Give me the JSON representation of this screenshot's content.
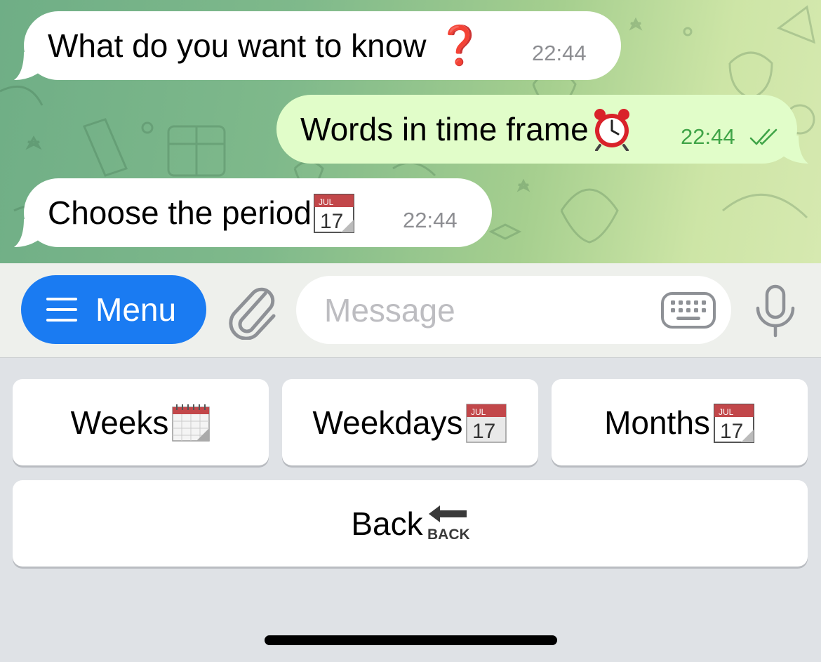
{
  "messages": [
    {
      "text": "What do you want to know",
      "emoji": "❓",
      "time": "22:44",
      "direction": "incoming"
    },
    {
      "text": "Words in time frame",
      "emoji": "alarm-clock",
      "time": "22:44",
      "direction": "outgoing",
      "status": "read"
    },
    {
      "text": "Choose the period",
      "emoji": "calendar",
      "time": "22:44",
      "direction": "incoming"
    }
  ],
  "input_bar": {
    "menu_label": "Menu",
    "placeholder": "Message",
    "value": ""
  },
  "reply_keyboard": {
    "row1": [
      {
        "label": "Weeks",
        "emoji": "spiral-calendar"
      },
      {
        "label": "Weekdays",
        "emoji": "calendar"
      },
      {
        "label": "Months",
        "emoji": "calendar"
      }
    ],
    "row2": [
      {
        "label": "Back",
        "emoji": "back-arrow"
      }
    ]
  },
  "calendar_emoji": {
    "month": "JUL",
    "day": "17"
  },
  "back_emoji_text": "BACK",
  "colors": {
    "accent": "#1a7bf2",
    "incoming_bubble": "#ffffff",
    "outgoing_bubble": "#e1fdc9",
    "outgoing_time": "#3fa447",
    "question_mark": "#d9162a",
    "calendar_header": "#c2474a"
  }
}
